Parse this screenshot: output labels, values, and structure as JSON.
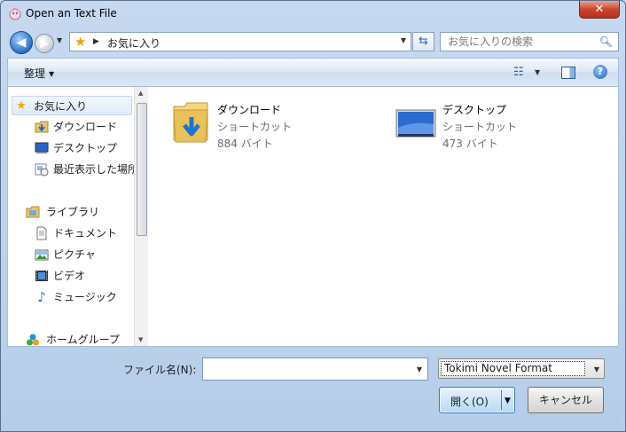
{
  "window": {
    "title": "Open an Text File",
    "close_label": "✕"
  },
  "nav": {
    "back_label": "◀",
    "forward_label": "▶",
    "address_crumb": "お気に入り",
    "search_placeholder": "お気に入りの検索"
  },
  "toolbar": {
    "organize_label": "整理"
  },
  "sidebar": {
    "items": [
      {
        "label": "お気に入り",
        "icon": "star-icon"
      },
      {
        "label": "ダウンロード",
        "icon": "download-folder-icon"
      },
      {
        "label": "デスクトップ",
        "icon": "desktop-icon"
      },
      {
        "label": "最近表示した場所",
        "icon": "recent-places-icon"
      },
      {
        "label": "ライブラリ",
        "icon": "library-icon"
      },
      {
        "label": "ドキュメント",
        "icon": "documents-icon"
      },
      {
        "label": "ピクチャ",
        "icon": "pictures-icon"
      },
      {
        "label": "ビデオ",
        "icon": "videos-icon"
      },
      {
        "label": "ミュージック",
        "icon": "music-icon"
      },
      {
        "label": "ホームグループ",
        "icon": "homegroup-icon"
      }
    ]
  },
  "files": [
    {
      "name": "ダウンロード",
      "type": "ショートカット",
      "size": "884 バイト",
      "icon": "download-folder-icon"
    },
    {
      "name": "デスクトップ",
      "type": "ショートカット",
      "size": "473 バイト",
      "icon": "desktop-icon"
    }
  ],
  "footer": {
    "filename_label": "ファイル名(N):",
    "filename_value": "",
    "filter_value": "Tokimi Novel Format",
    "open_label": "開く(O)",
    "cancel_label": "キャンセル"
  }
}
